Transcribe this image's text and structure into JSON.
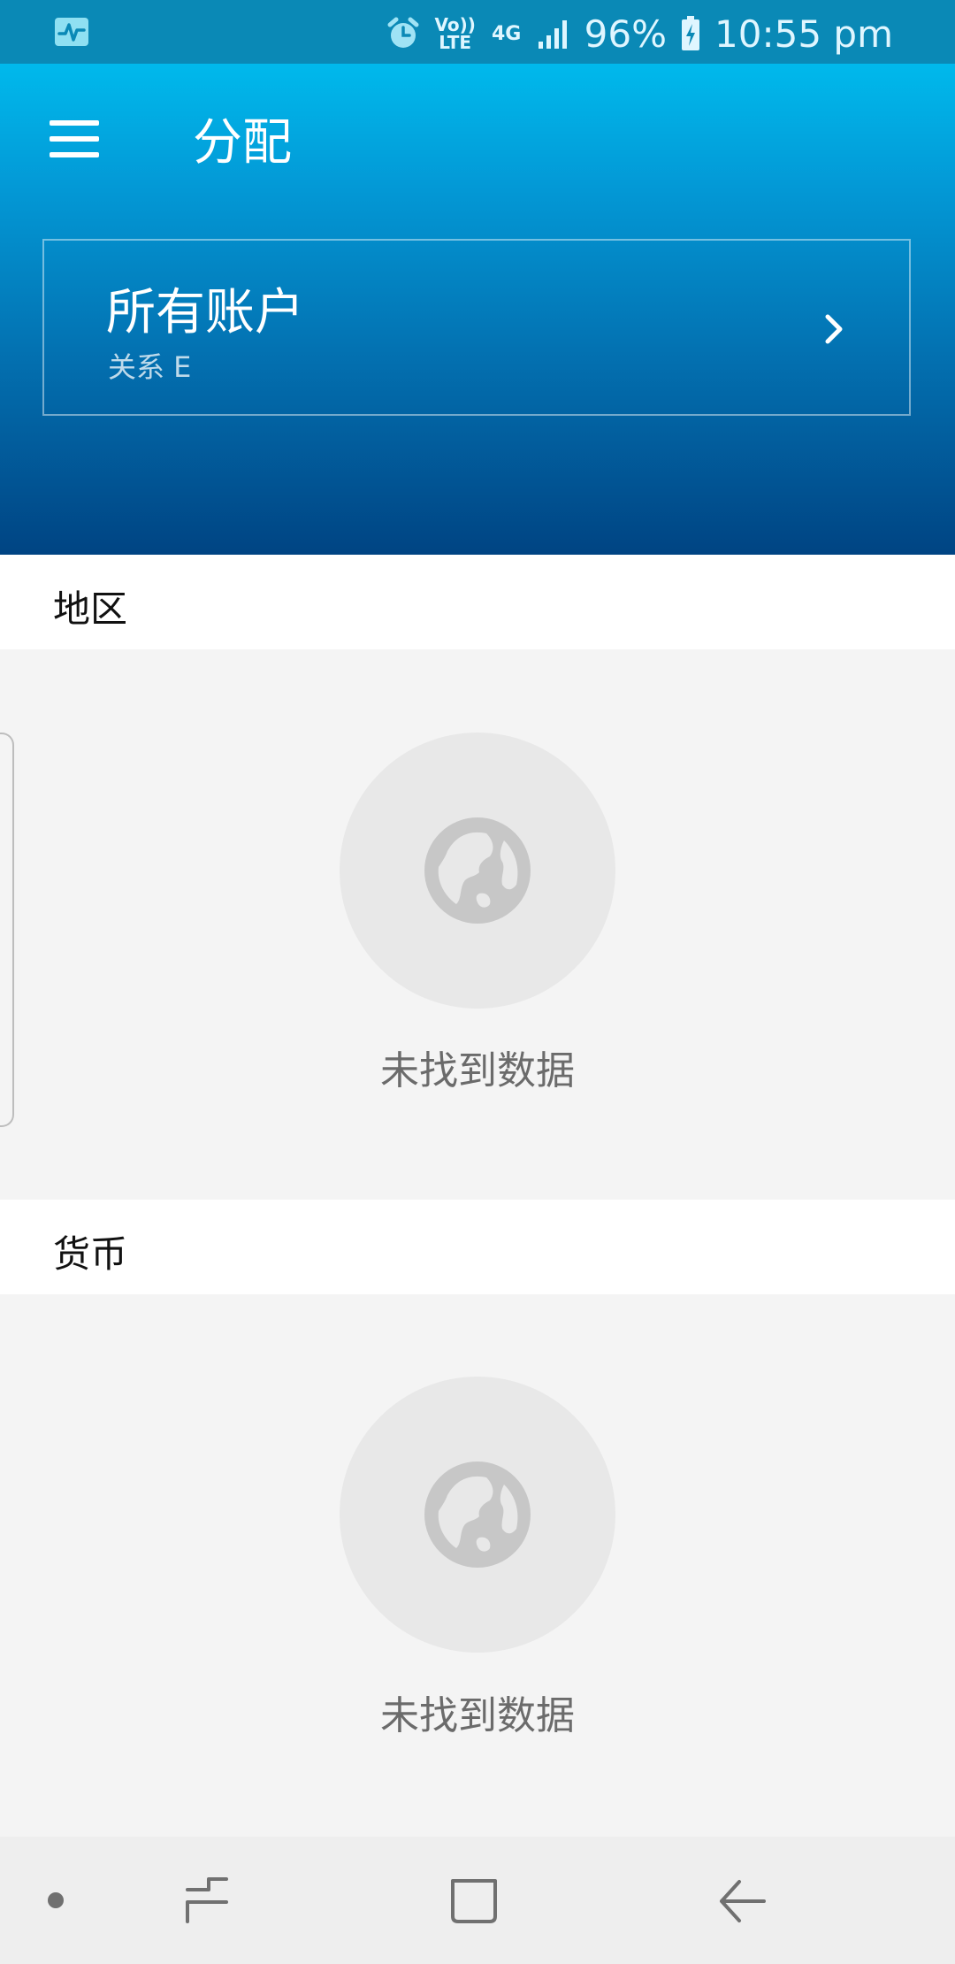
{
  "status_bar": {
    "volte": "Vo))\nLTE",
    "network": "4G",
    "battery": "96%",
    "time": "10:55 pm"
  },
  "header": {
    "title": "分配"
  },
  "account": {
    "title": "所有账户",
    "subtitle": "关系 E"
  },
  "sections": [
    {
      "title": "地区",
      "empty_text": "未找到数据"
    },
    {
      "title": "货币",
      "empty_text": "未找到数据"
    }
  ],
  "colors": {
    "status_bar": "#0a89b6",
    "header_top": "#00b9ec",
    "header_bottom": "#004483",
    "page_bg": "#f4f4f4",
    "empty_circle": "#e8e8e8",
    "empty_icon": "#c7c7c7"
  },
  "icons": {
    "menu": "hamburger-icon",
    "chevron": "chevron-right-icon",
    "empty": "globe-icon",
    "status_app": "activity-icon",
    "alarm": "alarm-icon",
    "signal": "signal-icon",
    "battery": "battery-charging-icon",
    "nav_recents": "recents-icon",
    "nav_home": "home-icon",
    "nav_back": "back-icon"
  }
}
